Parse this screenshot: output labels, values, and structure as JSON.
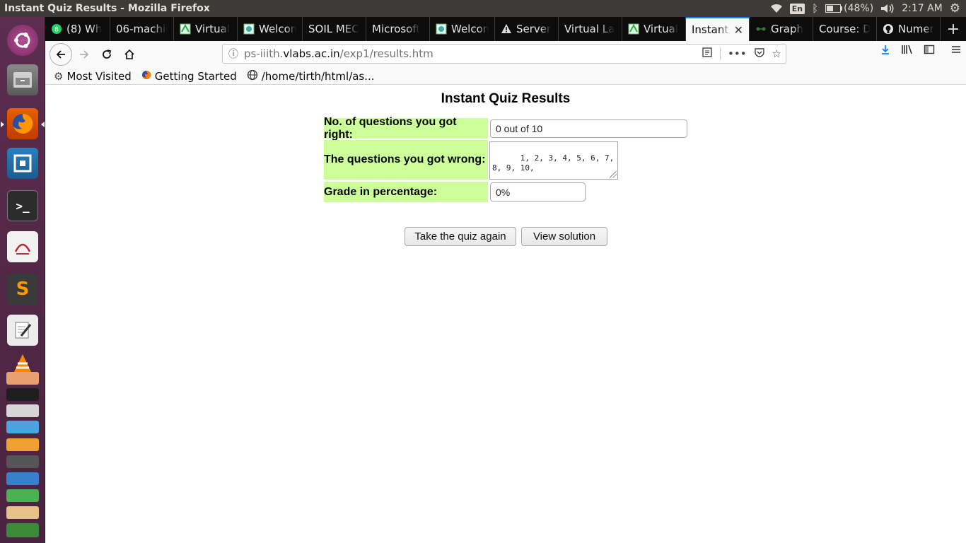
{
  "system": {
    "window_title": "Instant Quiz Results - Mozilla Firefox",
    "keyboard_layout": "En",
    "battery": "(48%)",
    "clock": "2:17 AM"
  },
  "launcher": {
    "apps": [
      "ubuntu-dash",
      "files",
      "firefox",
      "software-center",
      "terminal",
      "document-viewer",
      "sublime-text",
      "text-editor",
      "vlc",
      "stacked-apps"
    ]
  },
  "tabs": [
    {
      "label": "(8) Wh",
      "icon": "whatsapp-icon"
    },
    {
      "label": "06-machin",
      "icon": ""
    },
    {
      "label": "Virtual",
      "icon": "vlabs-icon"
    },
    {
      "label": "Welcom",
      "icon": "vlabs-icon"
    },
    {
      "label": "SOIL MEC",
      "icon": ""
    },
    {
      "label": "Microsoft",
      "icon": ""
    },
    {
      "label": "Welcom",
      "icon": "vlabs-icon"
    },
    {
      "label": "Server",
      "icon": "warning-icon"
    },
    {
      "label": "Virtual La",
      "icon": ""
    },
    {
      "label": "Virtual",
      "icon": "vlabs-icon"
    },
    {
      "label": "Instant",
      "icon": ""
    },
    {
      "label": "Graph",
      "icon": "graph-icon"
    },
    {
      "label": "Course: D",
      "icon": ""
    },
    {
      "label": "Numer",
      "icon": "github-icon"
    }
  ],
  "address_bar": {
    "prefix": "ps-iiith.",
    "domain": "vlabs.ac.in",
    "path": "/exp1/results.htm"
  },
  "bookmarks": [
    {
      "label": "Most Visited",
      "icon": "gear-icon"
    },
    {
      "label": "Getting Started",
      "icon": "firefox-icon"
    },
    {
      "label": "/home/tirth/html/as...",
      "icon": "globe-icon"
    }
  ],
  "page": {
    "title": "Instant Quiz Results",
    "right_label": "No. of questions you got right:",
    "right_value": "0 out of 10",
    "wrong_label": "The questions you got wrong:",
    "wrong_value": "1, 2, 3, 4, 5, 6, 7, 8, 9, 10,",
    "grade_label": "Grade in percentage:",
    "grade_value": "0%",
    "retake_button": "Take the quiz again",
    "solution_button": "View solution"
  }
}
